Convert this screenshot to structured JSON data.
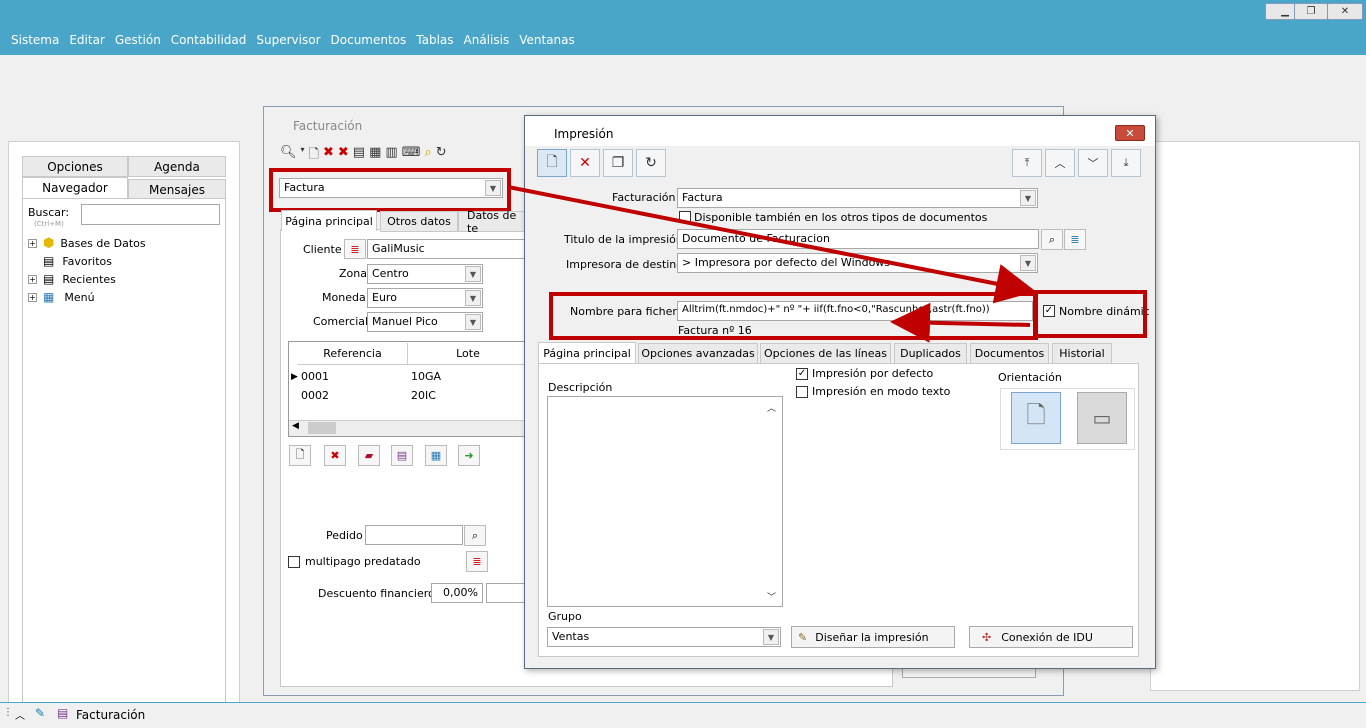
{
  "menu": [
    "Sistema",
    "Editar",
    "Gestión",
    "Contabilidad",
    "Supervisor",
    "Documentos",
    "Tablas",
    "Análisis",
    "Ventanas"
  ],
  "nav": {
    "tabs_top": [
      "Opciones",
      "Agenda"
    ],
    "tabs_bottom": [
      "Navegador",
      "Mensajes"
    ],
    "search_label": "Buscar:",
    "search_hint": "(Ctrl+M)",
    "tree": [
      "Bases de Datos",
      "Favoritos",
      "Recientes",
      "Menú"
    ]
  },
  "fact": {
    "title": "Facturación",
    "doc_type": "Factura",
    "tabs": [
      "Página principal",
      "Otros datos",
      "Datos de te"
    ],
    "cliente_label": "Cliente",
    "cliente": "GaliMusic",
    "zona_label": "Zona",
    "zona": "Centro",
    "moneda_label": "Moneda",
    "moneda": "Euro",
    "comercial_label": "Comercial",
    "comercial": "Manuel Pico",
    "grid_headers": [
      "Referencia",
      "Lote"
    ],
    "grid_rows": [
      [
        "0001",
        "10GA"
      ],
      [
        "0002",
        "20IC"
      ]
    ],
    "pedido_label": "Pedido",
    "multipago_label": "multipago predatado",
    "descuento_label": "Descuento financiero",
    "descuento": "0,00%"
  },
  "imp": {
    "title": "Impresión",
    "facturacion_label": "Facturación",
    "facturacion": "Factura",
    "disponible_label": "Disponible también en los otros tipos de documentos",
    "titulo_label": "Titulo de la impresión",
    "titulo": "Documento de Facturacion",
    "impresora_label": "Impresora de destino",
    "impresora": "> Impresora por defecto del Windows",
    "nombre_label": "Nombre para fichero",
    "nombre": "Alltrim(ft.nmdoc)+\" nº \"+ iif(ft.fno<0,\"Rascunho\",astr(ft.fno))",
    "nombre_preview": "Factura nº 16",
    "nombre_dinamico_label": "Nombre dinámic",
    "tabs": [
      "Página principal",
      "Opciones avanzadas",
      "Opciones de las líneas",
      "Duplicados",
      "Documentos",
      "Historial"
    ],
    "descripcion_label": "Descripción",
    "impresion_defecto_label": "Impresión por defecto",
    "impresion_texto_label": "Impresión en modo texto",
    "orientacion_label": "Orientación",
    "grupo_label": "Grupo",
    "grupo": "Ventas",
    "disenar_label": "Diseñar la impresión",
    "conexion_label": "Conexión de IDU"
  },
  "taskbar": {
    "item": "Facturación"
  },
  "colors": {
    "accent": "#4aa6c8",
    "highlight": "#c00000"
  }
}
